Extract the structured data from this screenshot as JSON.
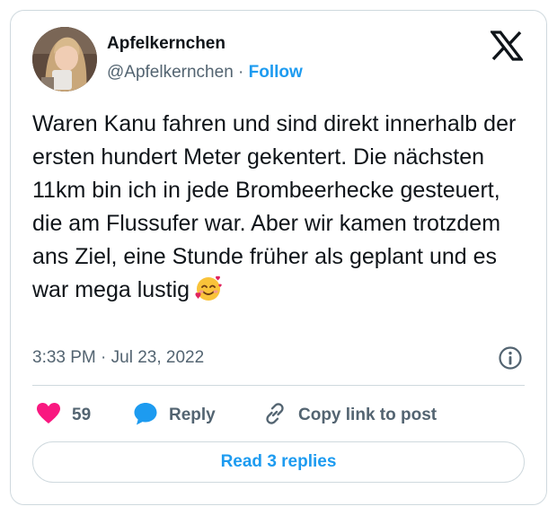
{
  "author": {
    "display_name": "Apfelkernchen",
    "handle": "@Apfelkernchen",
    "separator": " · ",
    "follow_label": "Follow",
    "avatar_icon": "user-avatar-photo"
  },
  "brand": {
    "logo_icon": "x-logo"
  },
  "tweet": {
    "text": "Waren Kanu fahren und sind direkt innerhalb der ersten hundert Meter gekentert. Die nächsten 11km bin ich in jede Brombeerhecke gesteuert, die am Flussufer war. Aber wir kamen trotzdem ans Ziel, eine Stunde früher als geplant und es war mega lustig",
    "emoji_icon": "smiling-face-with-hearts-icon",
    "timestamp": "3:33 PM · Jul 23, 2022"
  },
  "actions": {
    "like_count": "59",
    "reply_label": "Reply",
    "copy_label": "Copy link to post"
  },
  "read_replies_label": "Read 3 replies",
  "colors": {
    "accent": "#1d9bf0",
    "like": "#f91880",
    "text": "#0f1419",
    "secondary": "#536471",
    "border": "#cfd9de"
  }
}
